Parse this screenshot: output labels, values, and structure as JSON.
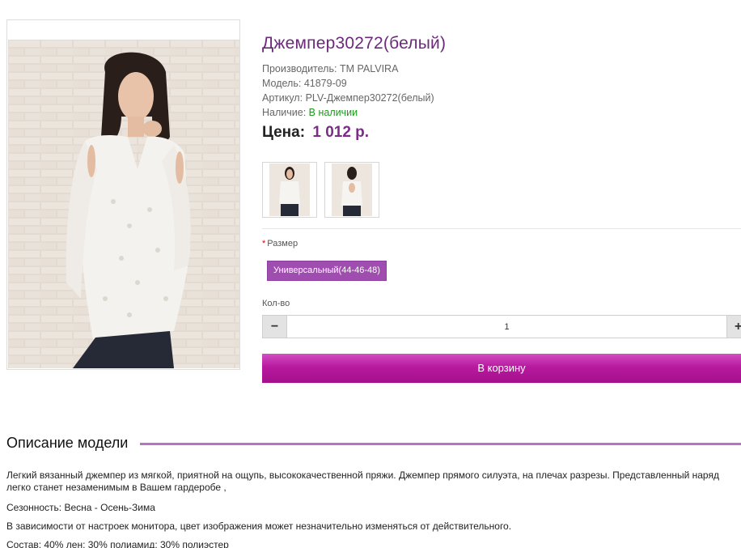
{
  "product": {
    "title": "Джемпер30272(белый)",
    "manufacturer_label": "Производитель:",
    "manufacturer": "TM PALVIRA",
    "model_label": "Модель:",
    "model": "41879-09",
    "sku_label": "Артикул:",
    "sku": "PLV-Джемпер30272(белый)",
    "stock_label": "Наличие:",
    "stock": "В наличии",
    "price_label": "Цена:",
    "price": "1 012 р."
  },
  "options": {
    "size_required": "*",
    "size_label": "Размер",
    "size_value": "Универсальный(44-46-48)",
    "qty_label": "Кол-во",
    "qty_value": "1",
    "minus": "−",
    "plus": "+"
  },
  "cart_button": "В корзину",
  "description": {
    "heading": "Описание модели",
    "p1": "Легкий вязанный джемпер из мягкой, приятной на ощупь, высококачественной пряжи. Джемпер прямого силуэта, на плечах разрезы. Представленный наряд легко станет незаменимым в Вашем гардеробе ,",
    "p2": "Сезонность:  Весна - Осень-Зима",
    "p3": "В зависимости от настроек монитора, цвет изображения может незначительно изменяться от действительного.",
    "p4": "Состав: 40% лен; 30% полиамид; 30% полиэстер"
  },
  "colors": {
    "accent": "#7a2c86",
    "button": "#b8199f",
    "size_chip": "#a04db0",
    "stock": "#1a9a1a"
  }
}
